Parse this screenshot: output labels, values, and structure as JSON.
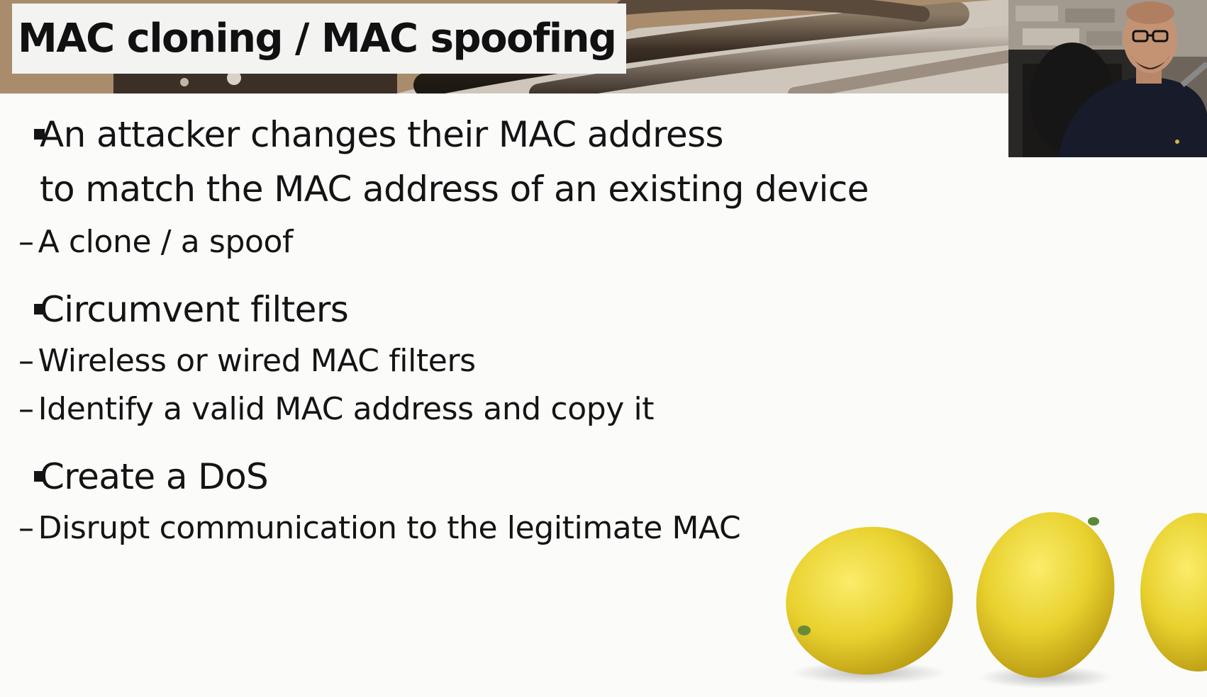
{
  "slide": {
    "title": "MAC cloning / MAC spoofing"
  },
  "bullets": {
    "b1_line1": "An attacker changes their MAC address",
    "b1_line2": "to match the MAC address of an existing device",
    "b1_sub1": "A clone / a spoof",
    "b2": "Circumvent filters",
    "b2_sub1": "Wireless or wired MAC filters",
    "b2_sub2": "Identify a valid MAC address and copy it",
    "b3": "Create a DoS",
    "b3_sub1": "Disrupt communication to the legitimate MAC"
  },
  "dash": "–",
  "colors": {
    "background": "#fbfbfa",
    "text": "#141414",
    "title_box": "#f3f3f2",
    "lemon": "#e8d12e"
  },
  "icons": {
    "bullet": "square-bullet-icon",
    "sub_bullet": "dash-icon"
  }
}
